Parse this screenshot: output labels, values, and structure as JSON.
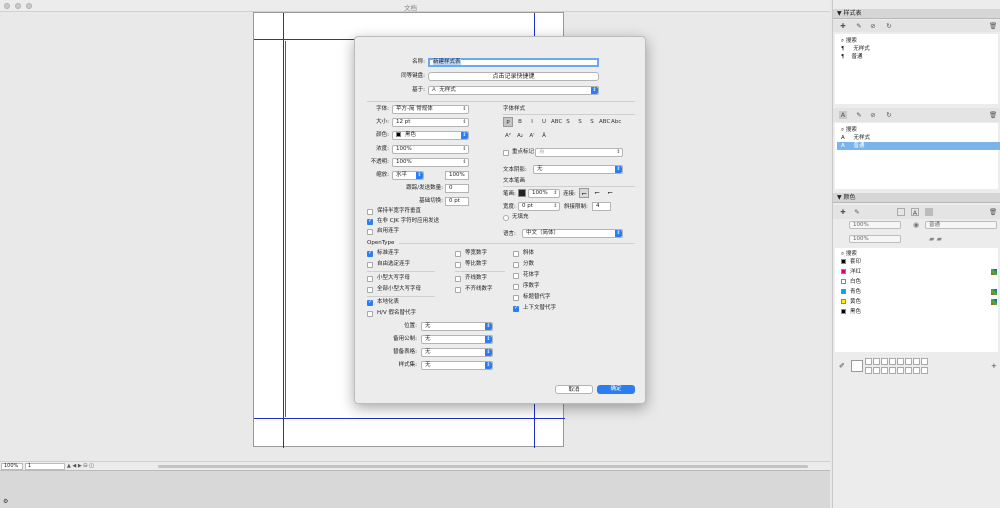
{
  "window": {
    "title": "文档"
  },
  "status": {
    "zoom": "100%",
    "page": "1"
  },
  "dialog": {
    "name_label": "名称:",
    "name_value": "新建样式表",
    "shortcut_label": "同等键盘:",
    "shortcut_btn": "点击记录快捷键",
    "based_label": "基于:",
    "based_value": "无样式",
    "font_label": "字体:",
    "font_value": "苹方-简 常规体",
    "size_label": "大小:",
    "size_value": "12 pt",
    "color_label": "颜色:",
    "color_value": "黑色",
    "shade_label": "浓度:",
    "shade_value": "100%",
    "opacity_label": "不透明:",
    "opacity_value": "100%",
    "scale_label": "缩放:",
    "scale_dir": "水平",
    "scale_value": "100%",
    "tracking_label": "跟踪/发送数量:",
    "tracking_value": "0",
    "baseline_label": "基础切换:",
    "baseline_value": "0 pt",
    "cb_halfwidth": "保持半宽字符垂直",
    "cb_cjk": "在非 CJK 字符时应用发送",
    "cb_ligatures": "启用连字",
    "opentype_title": "OpenType",
    "ot_standard": "标准连字",
    "ot_discretionary": "自由选定连字",
    "ot_smallcaps": "小型大写字母",
    "ot_allsmallcaps": "全部小型大写字母",
    "ot_tabular": "等宽数字",
    "ot_proportional": "等比数字",
    "ot_lining": "齐线数字",
    "ot_oldstyle": "不齐线数字",
    "ot_italic": "斜体",
    "ot_fractions": "分数",
    "ot_swash": "花体字",
    "ot_ordinals": "序数字",
    "ot_titling": "标题替代字",
    "ot_contextual": "上下文替代字",
    "ot_localized": "本地化表",
    "ot_hv": "H/V 假名替代字",
    "position_label": "位置:",
    "position_value": "无",
    "number_label": "备用公制:",
    "number_value": "无",
    "alt_label": "替备表格:",
    "alt_value": "无",
    "stylistic_label": "样式集:",
    "stylistic_value": "无",
    "type_style_title": "字体样式",
    "type_buttons": [
      "P",
      "B",
      "I",
      "U",
      "ABC",
      "S",
      "S",
      "S",
      "ABC",
      "Abc"
    ],
    "type_buttons2": [
      "A²",
      "A₂",
      "A'",
      "Ǎ"
    ],
    "underline_label": "重点标记",
    "underline_value": "点",
    "shadow_label": "文本阴影:",
    "shadow_value": "无",
    "stroke_title": "文本笔画",
    "stroke_label": "笔画:",
    "stroke_shade": "100%",
    "join_label": "连接:",
    "width_label": "宽度:",
    "width_value": "0 pt",
    "miter_label": "斜接限制:",
    "miter_value": "4",
    "nofill": "无填充",
    "lang_label": "语言:",
    "lang_value": "中文（简体）",
    "cancel": "取消",
    "ok": "确定"
  },
  "panels": {
    "styles": {
      "title": "样式表",
      "search": "搜索",
      "para": [
        "无样式",
        "普通"
      ],
      "char": [
        "无样式",
        "普通"
      ],
      "char_selected": 1
    },
    "colors": {
      "title": "颜色",
      "shade": "100%",
      "opacity": "100%",
      "mode": "普通",
      "search": "搜索",
      "list": [
        {
          "name": "套印",
          "color": "#000000"
        },
        {
          "name": "洋红",
          "color": "#d6007e"
        },
        {
          "name": "白色",
          "color": "#ffffff"
        },
        {
          "name": "青色",
          "color": "#00a0e4"
        },
        {
          "name": "黄色",
          "color": "#ffee00"
        },
        {
          "name": "黑色",
          "color": "#000000"
        }
      ]
    }
  },
  "colors": {
    "accent": "#2c7ef0",
    "selection": "#7ab4ea",
    "guide_blue": "#2030c8",
    "guide_green": "#0a8a60"
  }
}
